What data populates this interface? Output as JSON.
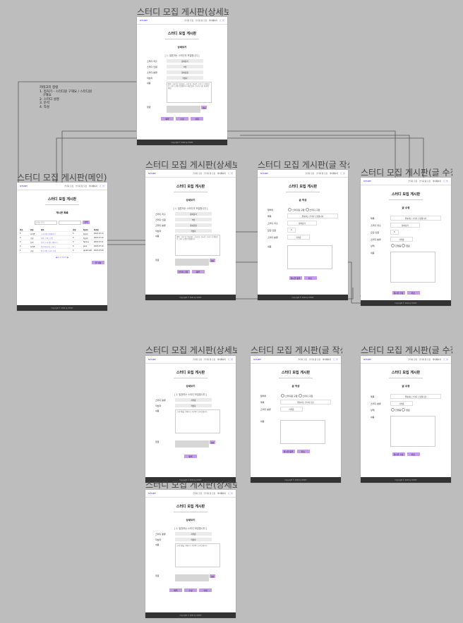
{
  "frames": [
    {
      "title": "스터디 모집 게시판(상세보기)",
      "kind": "detail-full",
      "page_title": "스터디 모집 게시판",
      "sub": "상세보기",
      "notice": "[ 1. 발표하는 스터디의 모집합니다 ]",
      "rows": [
        [
          "스터디 지출",
          "용이름기"
        ],
        [
          "스터디 인원",
          "5명"
        ],
        [
          "스터디 분류",
          "용이름용"
        ],
        [
          "작성자",
          "작성자"
        ]
      ],
      "body_label": "내용",
      "body_text": "제목: 스터디는 발표회는 스터디는 실시간 스터디 기 계획으로 스터디 선원\n모집합니다 계획 발표. 스터디 기간 개 취득 계획",
      "comment_label": "댓글",
      "comment_btn": "댓글",
      "buttons": [
        "목록",
        "수정",
        "삭제"
      ],
      "footer": "Copyright © 2022 by STUDY"
    },
    {
      "title": "스터디 모집 게시판(메인)",
      "kind": "main",
      "page_title": "스터디 모집 게시판",
      "sub": "게시판 목록",
      "search_placeholder": "검색어 입력",
      "search_btn": "검색",
      "columns": [
        "번호",
        "분류",
        "제목",
        "인원",
        "작성자",
        "작성일"
      ],
      "rows": [
        [
          "5",
          "자격증",
          "스터디원 모집합니다",
          "5",
          "작성자",
          "2022.07.13"
        ],
        [
          "4",
          "코딩",
          "자바 스터디 모집",
          "4",
          "작성자",
          "2022.07.12"
        ],
        [
          "3",
          "토익",
          "토익 스터디원 구합니다",
          "3",
          "Spring",
          "2022.07.11"
        ],
        [
          "2",
          "자격증",
          "정보처리기사 스터디",
          "6",
          "java",
          "2022.07.10"
        ],
        [
          "1",
          "코딩",
          "알고리즘 스터디 모집",
          "4",
          "JavaScript",
          "2022.07.09"
        ]
      ],
      "pagination": "◀ 1 2 3 4 5 ▶",
      "write_btn": "글 작성",
      "footer": "Copyright © 2022 by STUDY"
    },
    {
      "title": "스터디 모집 게시판(상세보기)",
      "kind": "detail-apply",
      "page_title": "스터디 모집 게시판",
      "sub": "상세보기",
      "notice": "[ 1. 발표하는 스터디의 모집합니다 ]",
      "rows": [
        [
          "스터디 지출",
          "용이름기"
        ],
        [
          "스터디 인원",
          "5명"
        ],
        [
          "스터디 분류",
          "용이름용"
        ],
        [
          "작성자",
          "작성자"
        ]
      ],
      "body_label": "내용",
      "body_text": "제목: 스터디는 발표회는 스터디는 실시간 스터디 기 계획으로 스터디 선원 모집합니다",
      "comment_label": "댓글",
      "comment_btn": "댓글",
      "buttons": [
        "스터디 신청",
        "목록"
      ],
      "footer": "Copyright © 2022 by STUDY"
    },
    {
      "title": "스터디 모집 게시판(글 작성)",
      "kind": "write",
      "page_title": "스터디 모집 게시판",
      "sub": "글 작성",
      "fields": [
        [
          "말머리",
          "스터디원 구함",
          "스터디 구함"
        ],
        [
          "제목",
          "발표하는 스터디 모집합니다"
        ],
        [
          "스터디 지출",
          "용이름기"
        ],
        [
          "모집 인원",
          "5"
        ],
        [
          "스터디 분류",
          "자격증"
        ]
      ],
      "body_label": "내용",
      "buttons": [
        "게시글 등록",
        "취소"
      ],
      "footer": "Copyright © 2022 by STUDY"
    },
    {
      "title": "스터디 모집 게시판(글 수정)",
      "kind": "edit",
      "page_title": "스터디 모집 게시판",
      "sub": "글 수정",
      "fields": [
        [
          "제목",
          "발표하는 스터디 모집합니다"
        ],
        [
          "스터디 지출",
          "용이름기"
        ],
        [
          "모집 인원",
          "5"
        ],
        [
          "스터디 분류",
          "자격증"
        ],
        [
          "상태",
          "진행중",
          "완료"
        ]
      ],
      "body_label": "내용",
      "buttons": [
        "게시글 수정",
        "취소"
      ],
      "footer": "Copyright © 2022 by STUDY"
    },
    {
      "title": "스터디 모집 게시판(상세보기)",
      "kind": "detail-mine",
      "page_title": "스터디 모집 게시판",
      "sub": "상세보기",
      "notice": "[ 1. 발표하는 스터디 모집합니다 ]",
      "rows": [
        [
          "스터디 분류",
          "자격증"
        ],
        [
          "작성자",
          "작성자"
        ]
      ],
      "body_label": "내용",
      "body_text": "스터디원을 구합니다.\n자격증 스터디 합니다.",
      "comment_label": "댓글",
      "comment_btn": "댓글",
      "buttons": [
        "목록"
      ],
      "footer": "Copyright © 2022 by STUDY"
    },
    {
      "title": "스터디 모집 게시판(글 작성)",
      "kind": "write2",
      "page_title": "스터디 모집 게시판",
      "sub": "글 작성",
      "fields": [
        [
          "말머리",
          "스터디원 구함",
          "스터디 구함"
        ],
        [
          "제목",
          "발표하는 스터디 모집"
        ],
        [
          "스터디 분류",
          "자격증"
        ]
      ],
      "body_label": "내용",
      "buttons": [
        "게시글 등록",
        "취소"
      ],
      "footer": "Copyright © 2022 by STUDY"
    },
    {
      "title": "스터디 모집 게시판(글 수정)",
      "kind": "edit2",
      "page_title": "스터디 모집 게시판",
      "sub": "글 수정",
      "fields": [
        [
          "제목",
          "발표하는 스터디 모집합니다"
        ],
        [
          "스터디 분류",
          "자격증"
        ],
        [
          "상태",
          "진행중",
          "완료"
        ]
      ],
      "body_label": "내용",
      "buttons": [
        "게시글 수정",
        "취소"
      ],
      "footer": "Copyright © 2022 by STUDY"
    },
    {
      "title": "스터디 모집 게시판(상세보기)",
      "kind": "detail-mine2",
      "page_title": "스터디 모집 게시판",
      "sub": "상세보기",
      "notice": "[ 1. 발표하는 스터디 모집합니다 ]",
      "rows": [
        [
          "스터디 분류",
          "자격증"
        ],
        [
          "작성자",
          "작성자"
        ]
      ],
      "body_label": "내용",
      "body_text": "스터디원을 구합니다.\n자격증 스터디 합니다.",
      "comment_label": "댓글",
      "comment_btn": "댓글",
      "buttons": [
        "목록",
        "수정",
        "삭제"
      ],
      "footer": "Copyright © 2022 by STUDY"
    }
  ],
  "nav": {
    "logo": "STUDY",
    "menu": [
      "스터디 모집",
      "스터디 정 모집",
      "마이페이지"
    ],
    "login": "로그인"
  },
  "note": "카테고리 정렬\n1. 정처기 - 스터디원 구해요 / 스터디원\n   구해요\n2. 스터디 설명\n3. 분석\n4. 작성"
}
